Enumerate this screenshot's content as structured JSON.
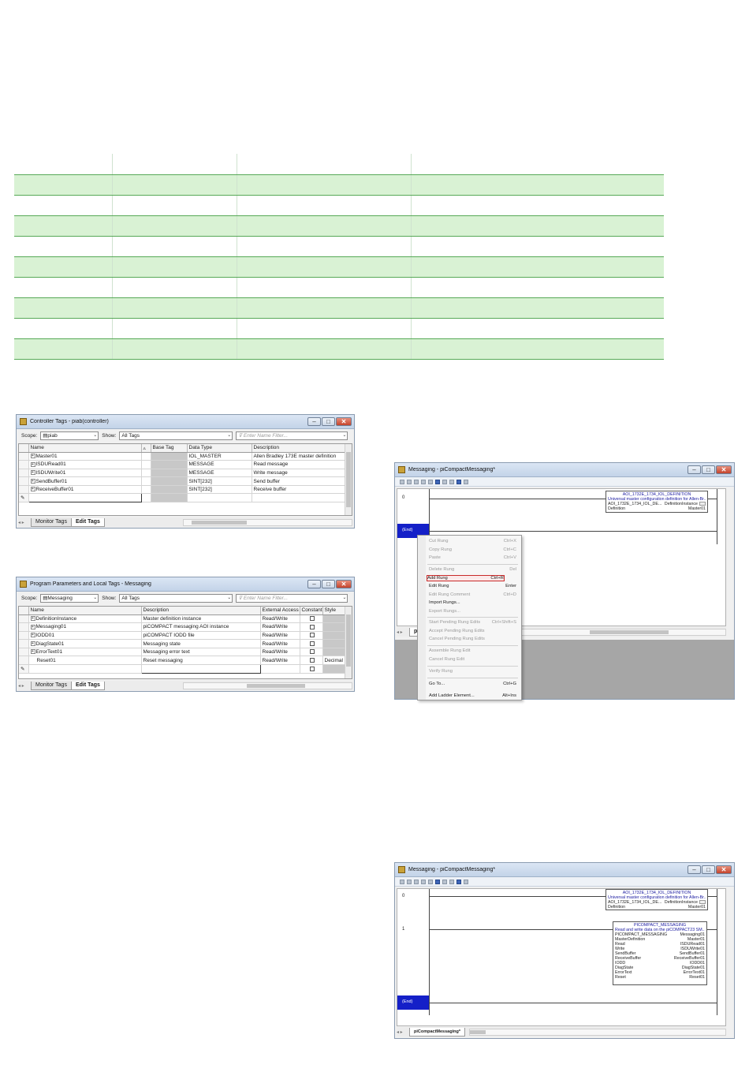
{
  "green_table": {
    "row_types": [
      "hdr",
      "g",
      "w",
      "g",
      "w",
      "g",
      "w",
      "g",
      "w",
      "g"
    ],
    "columns": 4
  },
  "controller_tags": {
    "title": "Controller Tags - piab(controller)",
    "scope_label": "Scope:",
    "scope_value": "piab",
    "show_label": "Show:",
    "show_value": "All Tags",
    "filter_placeholder": "Enter Name Filter...",
    "headers": [
      "Name",
      "Base Tag",
      "Data Type",
      "Description"
    ],
    "rows": [
      {
        "name": "Master01",
        "type": "IOL_MASTER",
        "desc": "Allen Bradley 173E master definition"
      },
      {
        "name": "ISDURead01",
        "type": "MESSAGE",
        "desc": "Read message"
      },
      {
        "name": "ISDUWrite01",
        "type": "MESSAGE",
        "desc": "Write message"
      },
      {
        "name": "SendBuffer01",
        "type": "SINT[232]",
        "desc": "Send buffer"
      },
      {
        "name": "ReceiveBuffer01",
        "type": "SINT[232]",
        "desc": "Receive buffer"
      }
    ],
    "tabs": [
      "Monitor Tags",
      "Edit Tags"
    ]
  },
  "program_tags": {
    "title": "Program Parameters and Local Tags - Messaging",
    "scope_label": "Scope:",
    "scope_value": "Messaging",
    "show_label": "Show:",
    "show_value": "All Tags",
    "filter_placeholder": "Enter Name Filter...",
    "headers": [
      "Name",
      "Description",
      "External Access",
      "Constant",
      "Style"
    ],
    "rows": [
      {
        "name": "DefinitionInstance",
        "desc": "Master definition instance",
        "access": "Read/Write",
        "style": ""
      },
      {
        "name": "Messaging01",
        "desc": "piCOMPACT messaging AOI instance",
        "access": "Read/Write",
        "style": ""
      },
      {
        "name": "IODD01",
        "desc": "piCOMPACT IODD file",
        "access": "Read/Write",
        "style": ""
      },
      {
        "name": "DiagState01",
        "desc": "Messaging state",
        "access": "Read/Write",
        "style": ""
      },
      {
        "name": "ErrorText01",
        "desc": "Messaging error text",
        "access": "Read/Write",
        "style": ""
      },
      {
        "name": "Reset01",
        "desc": "Reset messaging",
        "access": "Read/Write",
        "style": "Decimal"
      }
    ],
    "tabs": [
      "Monitor Tags",
      "Edit Tags"
    ]
  },
  "ladder1": {
    "title": "Messaging - piCompactMessaging*",
    "rung0": "0",
    "end": "(End)",
    "aoi": {
      "head": "AOI_1732E_1734_IOL_DEFINITION",
      "desc": "Universal master configuration definition for Allen-Br...",
      "line1_left": "AOI_1732E_1734_IOL_DE...",
      "line1_right": "DefinitionInstance",
      "line2_left": "Definition",
      "line2_right": "Master01"
    },
    "menu": [
      {
        "label": "Cut Rung",
        "key": "Ctrl+X",
        "dis": true
      },
      {
        "label": "Copy Rung",
        "key": "Ctrl+C",
        "dis": true
      },
      {
        "label": "Paste",
        "key": "Ctrl+V",
        "dis": true
      },
      {
        "label": "Delete Rung",
        "key": "Del",
        "dis": true
      },
      {
        "label": "Add Rung",
        "key": "Ctrl+R",
        "dis": false,
        "hl": true
      },
      {
        "label": "Edit Rung",
        "key": "Enter",
        "dis": false
      },
      {
        "label": "Edit Rung Comment",
        "key": "Ctrl+D",
        "dis": true
      },
      {
        "label": "Import Rungs...",
        "key": "",
        "dis": false
      },
      {
        "label": "Export Rungs...",
        "key": "",
        "dis": true
      },
      {
        "label": "Start Pending Rung Edits",
        "key": "Ctrl+Shift+S",
        "dis": true
      },
      {
        "label": "Accept Pending Rung Edits",
        "key": "",
        "dis": true
      },
      {
        "label": "Cancel Pending Rung Edits",
        "key": "",
        "dis": true
      },
      {
        "label": "Assemble Rung Edit",
        "key": "",
        "dis": true
      },
      {
        "label": "Cancel Rung Edit",
        "key": "",
        "dis": true
      },
      {
        "label": "Verify Rung",
        "key": "",
        "dis": true
      },
      {
        "label": "Go To...",
        "key": "Ctrl+G",
        "dis": false
      },
      {
        "label": "Add Ladder Element...",
        "key": "Alt+Ins",
        "dis": false
      }
    ],
    "tab": "piC"
  },
  "ladder2": {
    "title": "Messaging - piCompactMessaging*",
    "rung0": "0",
    "rung1": "1",
    "end": "(End)",
    "aoi1": {
      "head": "AOI_1732E_1734_IOL_DEFINITION",
      "desc": "Universal master configuration definition for Allen-Br...",
      "line1_left": "AOI_1732E_1734_IOL_DE...",
      "line1_right": "DefinitionInstance",
      "line2_left": "Definition",
      "line2_right": "Master01"
    },
    "aoi2": {
      "head": "PICOMPACT_MESSAGING",
      "desc": "Read and write data on the piCOMPACT23 SM...",
      "rows": [
        {
          "l": "PICOMPACT_MESSAGING",
          "r": "Messaging01"
        },
        {
          "l": "MasterDefinition",
          "r": "Master01"
        },
        {
          "l": "Read",
          "r": "ISDURead01"
        },
        {
          "l": "Write",
          "r": "ISDUWrite01"
        },
        {
          "l": "SendBuffer",
          "r": "SendBuffer01"
        },
        {
          "l": "ReceiveBuffer",
          "r": "ReceiveBuffer01"
        },
        {
          "l": "IODD",
          "r": "IODD01"
        },
        {
          "l": "DiagState",
          "r": "DiagState01"
        },
        {
          "l": "ErrorText",
          "r": "ErrorText01"
        },
        {
          "l": "Reset",
          "r": "Reset01"
        }
      ]
    },
    "tab": "piCompactMessaging*"
  }
}
